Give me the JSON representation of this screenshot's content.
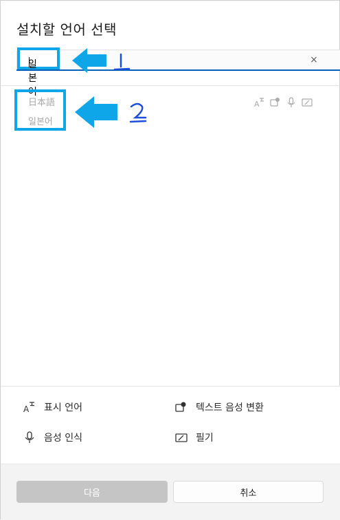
{
  "dialog": {
    "title": "설치할 언어 선택",
    "search": {
      "value": "일본어",
      "placeholder": ""
    },
    "clear_icon": "×",
    "results": [
      {
        "native_name": "日本語",
        "local_name": "일본어"
      }
    ],
    "annotations": {
      "label_1": "1",
      "label_2": "2"
    },
    "legend": {
      "display_language": "표시 언어",
      "text_to_speech": "텍스트 음성 변환",
      "speech_recognition": "음성 인식",
      "handwriting": "필기"
    },
    "buttons": {
      "next": "다음",
      "cancel": "취소"
    }
  },
  "colors": {
    "accent": "#005fb8",
    "annotation": "#0ea5e9",
    "disabled_button": "#c5c5c5"
  }
}
